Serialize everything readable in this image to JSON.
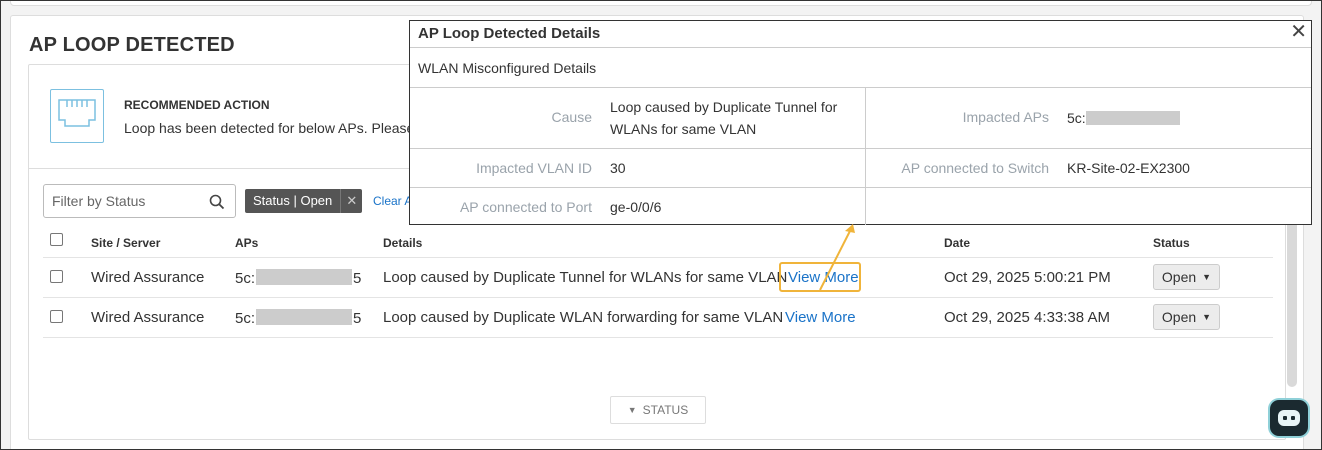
{
  "panel": {
    "title": "AP LOOP DETECTED",
    "recommended": {
      "title": "RECOMMENDED ACTION",
      "text": "Loop has been detected for below APs. Please"
    },
    "filter": {
      "placeholder": "Filter by Status",
      "chip_label": "Status | Open",
      "clear_label": "Clear A"
    },
    "table": {
      "headers": [
        "Site / Server",
        "APs",
        "Details",
        "Date",
        "Status"
      ],
      "rows": [
        {
          "site": "Wired Assurance",
          "ap_prefix": "5c:",
          "ap_suffix": "5",
          "details": "Loop caused by Duplicate Tunnel for WLANs for same VLAN",
          "link": "View More",
          "date": "Oct 29, 2025 5:00:21 PM",
          "status": "Open"
        },
        {
          "site": "Wired Assurance",
          "ap_prefix": "5c:",
          "ap_suffix": "5",
          "details": "Loop caused by Duplicate WLAN forwarding for same VLAN",
          "link": "View More",
          "date": "Oct 29, 2025 4:33:38 AM",
          "status": "Open"
        }
      ]
    },
    "status_filter_label": "STATUS"
  },
  "popup": {
    "title": "AP Loop Detected Details",
    "close": "✕",
    "subtitle": "WLAN Misconfigured Details",
    "fields": {
      "cause_label": "Cause",
      "cause_value": "Loop caused by Duplicate Tunnel for WLANs for same VLAN",
      "impacted_aps_label": "Impacted APs",
      "impacted_aps_prefix": "5c:",
      "vlan_label": "Impacted VLAN ID",
      "vlan_value": "30",
      "switch_label": "AP connected to Switch",
      "switch_value": "KR-Site-02-EX2300",
      "port_label": "AP connected to Port",
      "port_value": "ge-0/0/6"
    }
  },
  "colors": {
    "link": "#1a73c8",
    "highlight": "#f0b43a",
    "chip": "#555555"
  },
  "icons": [
    "ethernet-port-icon",
    "search-icon",
    "close-icon",
    "caret-down-icon",
    "chatbot-icon"
  ]
}
